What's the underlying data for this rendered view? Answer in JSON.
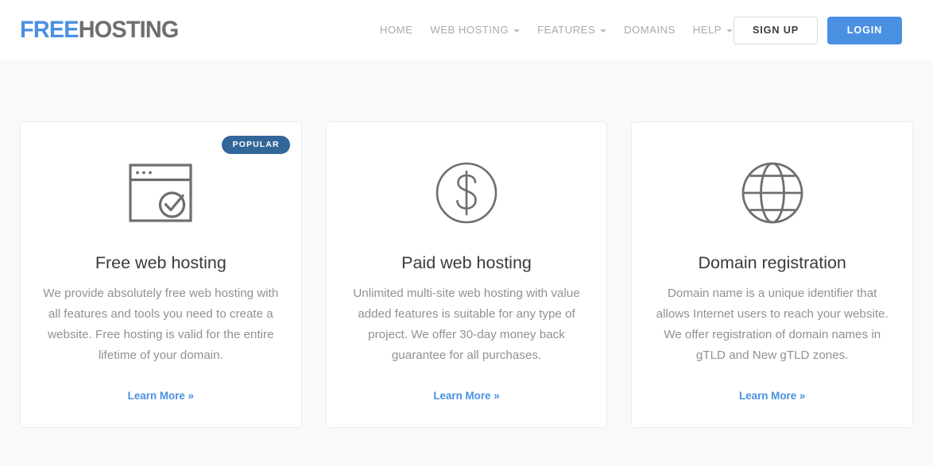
{
  "header": {
    "logo": {
      "part1": "FREE",
      "part2": "HOSTING",
      "color1": "#4a90e2",
      "color2": "#6e6e6e"
    },
    "nav": [
      {
        "label": "HOME",
        "has_dropdown": false,
        "name": "home"
      },
      {
        "label": "WEB HOSTING",
        "has_dropdown": true,
        "name": "web-hosting"
      },
      {
        "label": "FEATURES",
        "has_dropdown": true,
        "name": "features"
      },
      {
        "label": "DOMAINS",
        "has_dropdown": false,
        "name": "domains"
      },
      {
        "label": "HELP",
        "has_dropdown": true,
        "name": "help"
      }
    ],
    "signup_label": "SIGN UP",
    "login_label": "LOGIN",
    "login_color": "#4a90e2"
  },
  "cards": [
    {
      "badge": "POPULAR",
      "badge_color": "#336699",
      "icon": "browser-check-icon",
      "title": "Free web hosting",
      "text": "We provide absolutely free web hosting with all features and tools you need to create a website. Free hosting is valid for the entire lifetime of your domain.",
      "link": "Learn More »"
    },
    {
      "badge": null,
      "icon": "dollar-circle-icon",
      "title": "Paid web hosting",
      "text": "Unlimited multi-site web hosting with value added features is suitable for any type of project. We offer 30-day money back guarantee for all purchases.",
      "link": "Learn More »"
    },
    {
      "badge": null,
      "icon": "globe-icon",
      "title": "Domain registration",
      "text": "Domain name is a unique identifier that allows Internet users to reach your website. We offer registration of domain names in gTLD and New gTLD zones.",
      "link": "Learn More »"
    }
  ]
}
